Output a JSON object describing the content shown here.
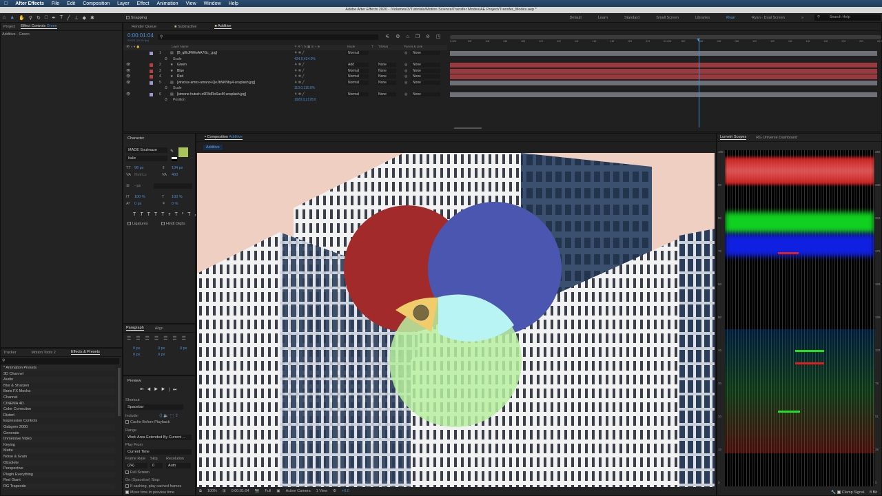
{
  "menubar": {
    "app": "After Effects",
    "items": [
      "File",
      "Edit",
      "Composition",
      "Layer",
      "Effect",
      "Animation",
      "View",
      "Window",
      "Help"
    ]
  },
  "titlebar": {
    "title": "Adobe After Effects 2020 - /Volumes/3/Tutorials/Motion Science/Transfer Modes/AE Project/Transfer_Modes.aep *"
  },
  "toolbar": {
    "snapping": "Snapping",
    "workspaces": [
      "Default",
      "Learn",
      "Standard",
      "Small Screen",
      "Libraries",
      "Ryan",
      "Ryan - Dual Screen"
    ],
    "active_workspace": "Ryan",
    "search_placeholder": "Search Help"
  },
  "project_panel": {
    "tabs": [
      "Project",
      "Effect Controls"
    ],
    "effect_controls_layer": "Green",
    "subtitle": "Additive - Green"
  },
  "timeline": {
    "tabs": [
      "Render Queue",
      "Subtractive",
      "Additive"
    ],
    "active_tab": "Additive",
    "timecode": "0:00:01:04",
    "fps": "00028 (24.00 fps)",
    "headers": {
      "layer_name": "Layer Name",
      "mode": "Mode",
      "t": "T",
      "trkmat": "TrkMat",
      "parent": "Parent & Link"
    },
    "ruler": [
      "0:00f",
      "02f",
      "04f",
      "06f",
      "08f",
      "10f",
      "12f",
      "14f",
      "16f",
      "18f",
      "20f",
      "22f",
      "01:00f",
      "02f",
      "04f",
      "06f",
      "08f",
      "10f",
      "12f",
      "14f",
      "16f",
      "18f",
      "20f",
      "22f",
      "02:0"
    ],
    "layers": [
      {
        "num": "1",
        "name": "[B_q8kJRWwAA7Gc_.jpg]",
        "mode": "Normal",
        "trkmat": "",
        "parent": "None",
        "label": "#9a9ad0",
        "prop": {
          "name": "Scale",
          "value": "424.0,424.0%"
        }
      },
      {
        "num": "2",
        "name": "Green",
        "mode": "Add",
        "trkmat": "None",
        "parent": "None",
        "label": "#b84040"
      },
      {
        "num": "3",
        "name": "Blue",
        "mode": "Normal",
        "trkmat": "None",
        "parent": "None",
        "label": "#b84040"
      },
      {
        "num": "4",
        "name": "Red",
        "mode": "Normal",
        "trkmat": "None",
        "parent": "None",
        "label": "#b84040"
      },
      {
        "num": "5",
        "name": "[vinicius-amnx-amano-lQeJbNKNby4-unsplash.jpg]",
        "mode": "Normal",
        "trkmat": "None",
        "parent": "None",
        "label": "#9a9ad0",
        "prop": {
          "name": "Scale",
          "value": "110.0,110.0%"
        }
      },
      {
        "num": "6",
        "name": "[simone-hutsch-o9F8dRoSucM-unsplash.jpg]",
        "mode": "Normal",
        "trkmat": "None",
        "parent": "None",
        "label": "#9a9ad0",
        "prop": {
          "name": "Position",
          "value": "1920.0,2178.0"
        }
      }
    ]
  },
  "character": {
    "title": "Character",
    "font": "MADE Soulmaze",
    "style": "Italic",
    "size": "96 px",
    "leading": "104 px",
    "kerning": "Metrics",
    "tracking": "400",
    "stroke": "- px",
    "vscale": "100 %",
    "hscale": "100 %",
    "baseline": "0 px",
    "tsume": "0 %",
    "ligatures": "Ligatures",
    "hindi": "Hindi Digits",
    "fill_color": "#a9c45a"
  },
  "paragraph": {
    "tabs": [
      "Paragraph",
      "Align"
    ],
    "values": [
      "0 px",
      "0 px",
      "0 px",
      "0 px",
      "0 px"
    ]
  },
  "preview": {
    "title": "Preview",
    "shortcut_label": "Shortcut",
    "shortcut": "Spacebar",
    "include": "Include:",
    "cache": "Cache Before Playback",
    "range_label": "Range",
    "range": "Work Area Extended By Current ...",
    "playfrom_label": "Play From",
    "playfrom": "Current Time",
    "framerate_label": "Frame Rate",
    "skip_label": "Skip",
    "resolution_label": "Resolution",
    "framerate": "(24)",
    "skip": "0",
    "resolution": "Auto",
    "fullscreen": "Full Screen",
    "stop_label": "On (Spacebar) Stop:",
    "opt1": "If caching, play cached frames",
    "opt2": "Move time to preview time"
  },
  "effects": {
    "tabs": [
      "Tracker",
      "Motion Tools 2",
      "Effects & Presets"
    ],
    "items": [
      "* Animation Presets",
      "3D Channel",
      "Audio",
      "Blur & Sharpen",
      "Boris FX Mocha",
      "Channel",
      "CINEMA 4D",
      "Color Correction",
      "Distort",
      "Expression Controls",
      "Gabgren 2000",
      "Generate",
      "Immersive Video",
      "Keying",
      "Matte",
      "Noise & Grain",
      "Obsolete",
      "Perspective",
      "Plugin Everything",
      "Red Giant",
      "RG Trapcode"
    ]
  },
  "composition": {
    "tab": "Composition",
    "name": "Additive",
    "crumb": "Additive",
    "zoom": "100%",
    "timecode": "0:00:01:04",
    "resolution": "Full",
    "camera": "Active Camera",
    "view": "1 View",
    "exposure": "+0.0",
    "colors": {
      "red": "#a32a2a",
      "blue": "#4a56b0",
      "yellow": "#f0cc6a",
      "cyan": "#b8f4f4",
      "green": "#b8f0a0",
      "sky": "#eecfc1"
    }
  },
  "scopes": {
    "tabs": [
      "Lumetri Scopes",
      "RG Universe Dashboard"
    ],
    "left_axis": [
      "100",
      "90",
      "80",
      "70",
      "60",
      "50",
      "40",
      "30",
      "20",
      "10",
      "0"
    ],
    "right_axis": [
      "255",
      "230",
      "204",
      "178",
      "153",
      "128",
      "102",
      "76",
      "51",
      "26",
      "0"
    ],
    "clamp": "Clamp Signal",
    "bits": "8 Bit"
  }
}
